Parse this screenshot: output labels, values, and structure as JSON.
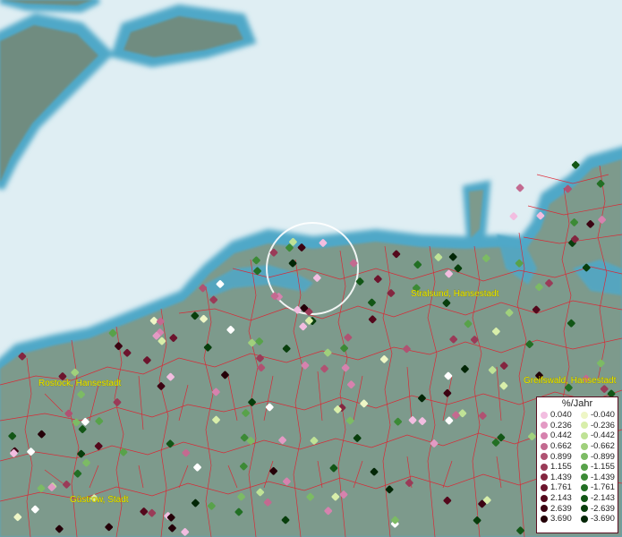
{
  "map": {
    "cities": [
      {
        "name": "Stralsund, Hansestadt"
      },
      {
        "name": "Rostock, Hansestadt"
      },
      {
        "name": "Greifswald, Hansestadt"
      },
      {
        "name": "Güstrow, Stadt"
      }
    ],
    "colors": {
      "sea": "#dfeef3",
      "land": "#7d9a8c",
      "coast": "#4fa8c8",
      "boundary": "#e0202e"
    },
    "focus_circle": "highlight-ring"
  },
  "legend": {
    "title": "%/Jahr",
    "positive": [
      {
        "label": "0.040",
        "color": "#f2bde0"
      },
      {
        "label": "0.236",
        "color": "#e39ac4"
      },
      {
        "label": "0.442",
        "color": "#d682ae"
      },
      {
        "label": "0.662",
        "color": "#c36a90"
      },
      {
        "label": "0.899",
        "color": "#b05272"
      },
      {
        "label": "1.155",
        "color": "#9a3b58"
      },
      {
        "label": "1.439",
        "color": "#842640"
      },
      {
        "label": "1.761",
        "color": "#6c142d"
      },
      {
        "label": "2.143",
        "color": "#54081c"
      },
      {
        "label": "2.639",
        "color": "#3c0312"
      },
      {
        "label": "3.690",
        "color": "#240008"
      }
    ],
    "negative": [
      {
        "label": "-0.040",
        "color": "#eef6c6"
      },
      {
        "label": "-0.236",
        "color": "#d8eeaa"
      },
      {
        "label": "-0.442",
        "color": "#bfe296"
      },
      {
        "label": "-0.662",
        "color": "#a0d07c"
      },
      {
        "label": "-0.899",
        "color": "#7cbb64"
      },
      {
        "label": "-1.155",
        "color": "#58a24a"
      },
      {
        "label": "-1.439",
        "color": "#3c8a36"
      },
      {
        "label": "-1.761",
        "color": "#226f24"
      },
      {
        "label": "-2.143",
        "color": "#125616"
      },
      {
        "label": "-2.639",
        "color": "#083e0c"
      },
      {
        "label": "-3.690",
        "color": "#022606"
      }
    ]
  }
}
